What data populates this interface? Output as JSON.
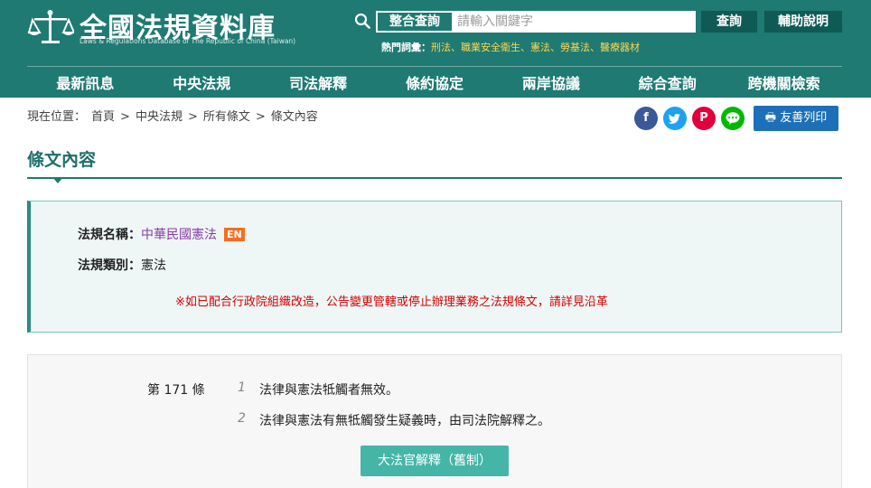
{
  "header": {
    "title": "全國法規資料庫",
    "subtitle": "Laws & Regulations Database of The Republic of China (Taiwan)",
    "logo_icon": "scales-of-justice-icon"
  },
  "search": {
    "scope_label": "整合查詢",
    "placeholder": "請輸入關鍵字",
    "value": "",
    "query_label": "查詢",
    "help_label": "輔助說明",
    "hot_label": "熱門詞彙：",
    "hot_keywords": [
      "刑法",
      "職業安全衛生",
      "憲法",
      "勞基法",
      "醫療器材"
    ],
    "separator": "、"
  },
  "nav": {
    "items": [
      "最新訊息",
      "中央法規",
      "司法解釋",
      "條約協定",
      "兩岸協議",
      "綜合查詢",
      "跨機關檢索"
    ]
  },
  "breadcrumb": {
    "prefix": "現在位置：",
    "items": [
      "首頁",
      "中央法規",
      "所有條文",
      "條文內容"
    ],
    "separator": ">"
  },
  "share": {
    "facebook": "f",
    "twitter": "t",
    "plurk": "P",
    "line": "…",
    "print_label": "友善列印",
    "colors": {
      "facebook": "#3b5998",
      "twitter": "#1da1f2",
      "plurk": "#e0003c",
      "line": "#00b900"
    }
  },
  "page": {
    "title": "條文內容"
  },
  "law_info": {
    "name_label": "法規名稱：",
    "name_value": "中華民國憲法",
    "en_badge": "EN",
    "category_label": "法規類別：",
    "category_value": "憲法",
    "notice": "※如已配合行政院組織改造，公告變更管轄或停止辦理業務之法規條文，請詳見沿革"
  },
  "article": {
    "number": "第 171 條",
    "paragraphs": [
      {
        "no": "1",
        "text": "法律與憲法牴觸者無效。"
      },
      {
        "no": "2",
        "text": "法律與憲法有無牴觸發生疑義時，由司法院解釋之。"
      }
    ],
    "interpretation_button": "大法官解釋（舊制）"
  },
  "colors": {
    "header_bg": "#1e7a72",
    "accent": "#45b5a8",
    "notice": "#d20000"
  }
}
